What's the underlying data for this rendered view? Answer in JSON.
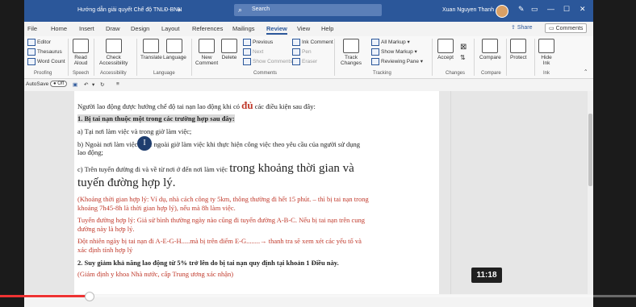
{
  "window": {
    "doc_title": "Hướng dẫn giải quyết Chế độ TNLĐ-BNN",
    "search_placeholder": "Search",
    "user_name": "Xuan Nguyen Thanh"
  },
  "tabs": [
    "File",
    "Home",
    "Insert",
    "Draw",
    "Design",
    "Layout",
    "References",
    "Mailings",
    "Review",
    "View",
    "Help"
  ],
  "active_tab": "Review",
  "share_label": "Share",
  "comments_label": "Comments",
  "ribbon": {
    "proofing": {
      "editor": "Editor",
      "thesaurus": "Thesaurus",
      "word_count": "Word Count",
      "group": "Proofing"
    },
    "speech": {
      "read_aloud_1": "Read",
      "read_aloud_2": "Aloud",
      "group": "Speech"
    },
    "accessibility": {
      "label_1": "Check",
      "label_2": "Accessibility",
      "group": "Accessibility"
    },
    "language": {
      "translate": "Translate",
      "language": "Language",
      "group": "Language"
    },
    "comments": {
      "new_1": "New",
      "new_2": "Comment",
      "delete": "Delete",
      "previous": "Previous",
      "next": "Next",
      "show_comments": "Show Comments",
      "group": "Comments"
    },
    "ink": {
      "ink_comment": "Ink Comment",
      "pen": "Pen",
      "eraser": "Eraser"
    },
    "tracking": {
      "track_1": "Track",
      "track_2": "Changes",
      "all_markup": "All Markup",
      "show_markup": "Show Markup",
      "reviewing_pane": "Reviewing Pane",
      "group": "Tracking"
    },
    "changes": {
      "accept": "Accept",
      "group": "Changes"
    },
    "compare": {
      "compare": "Compare",
      "group": "Compare"
    },
    "protect": {
      "protect": "Protect"
    },
    "ink_group": {
      "hide_1": "Hide",
      "hide_2": "Ink",
      "group": "Ink"
    }
  },
  "qat": {
    "autosave": "AutoSave",
    "autosave_state": "Off"
  },
  "doc_lines": {
    "l1a": "Người lao động được hưởng chế độ tai nạn lao động khi có ",
    "l1b": "đủ",
    "l1c": " các điều kiện sau đây:",
    "l2": "1. Bị tai nạn thuộc một trong các trường hợp sau đây:",
    "l3": "a) Tại nơi làm việc và trong giờ làm việc;",
    "l4": "b) Ngoài nơi làm việc hoặc ngoài giờ làm việc khi thực hiện công việc theo yêu cầu của người sử dụng",
    "l5": "lao động;",
    "l6a": "c) Trên tuyến đường đi và về từ nơi ở đến nơi làm việc ",
    "l6b": "trong khoảng thời gian và",
    "l7": "tuyến đường hợp lý.",
    "l8": "(Khoảng thời gian hợp lý: Ví dụ, nhà cách công ty 5km, thông thường đi hết 15 phút. – thì bị tai nạn trong",
    "l9": "khoảng 7h45-8h là thời gian hợp lý), nếu mà 8h làm việc.",
    "l10": "Tuyến đường hợp lý: Giả sử bình thường ngày nào cũng đi tuyến đường A-B-C. Nếu bị tai nạn trên cung",
    "l11": "đường này là hợp lý.",
    "l12": "Đột nhiên ngày bị tai nạn đi A-E-G-H.....mà bị trên điểm E-G........→ thanh tra sẽ xem xét các yếu tố và",
    "l13": "xác định tính hợp lý",
    "l14": "2. Suy giảm khả năng lao động từ 5% trở lên do bị tai nạn quy định tại khoản 1 Điều này.",
    "l15": "(Giám định y khoa Nhà nước, cấp Trung ương xác nhận)"
  },
  "video": {
    "timestamp": "11:18",
    "progress": 0.14
  }
}
